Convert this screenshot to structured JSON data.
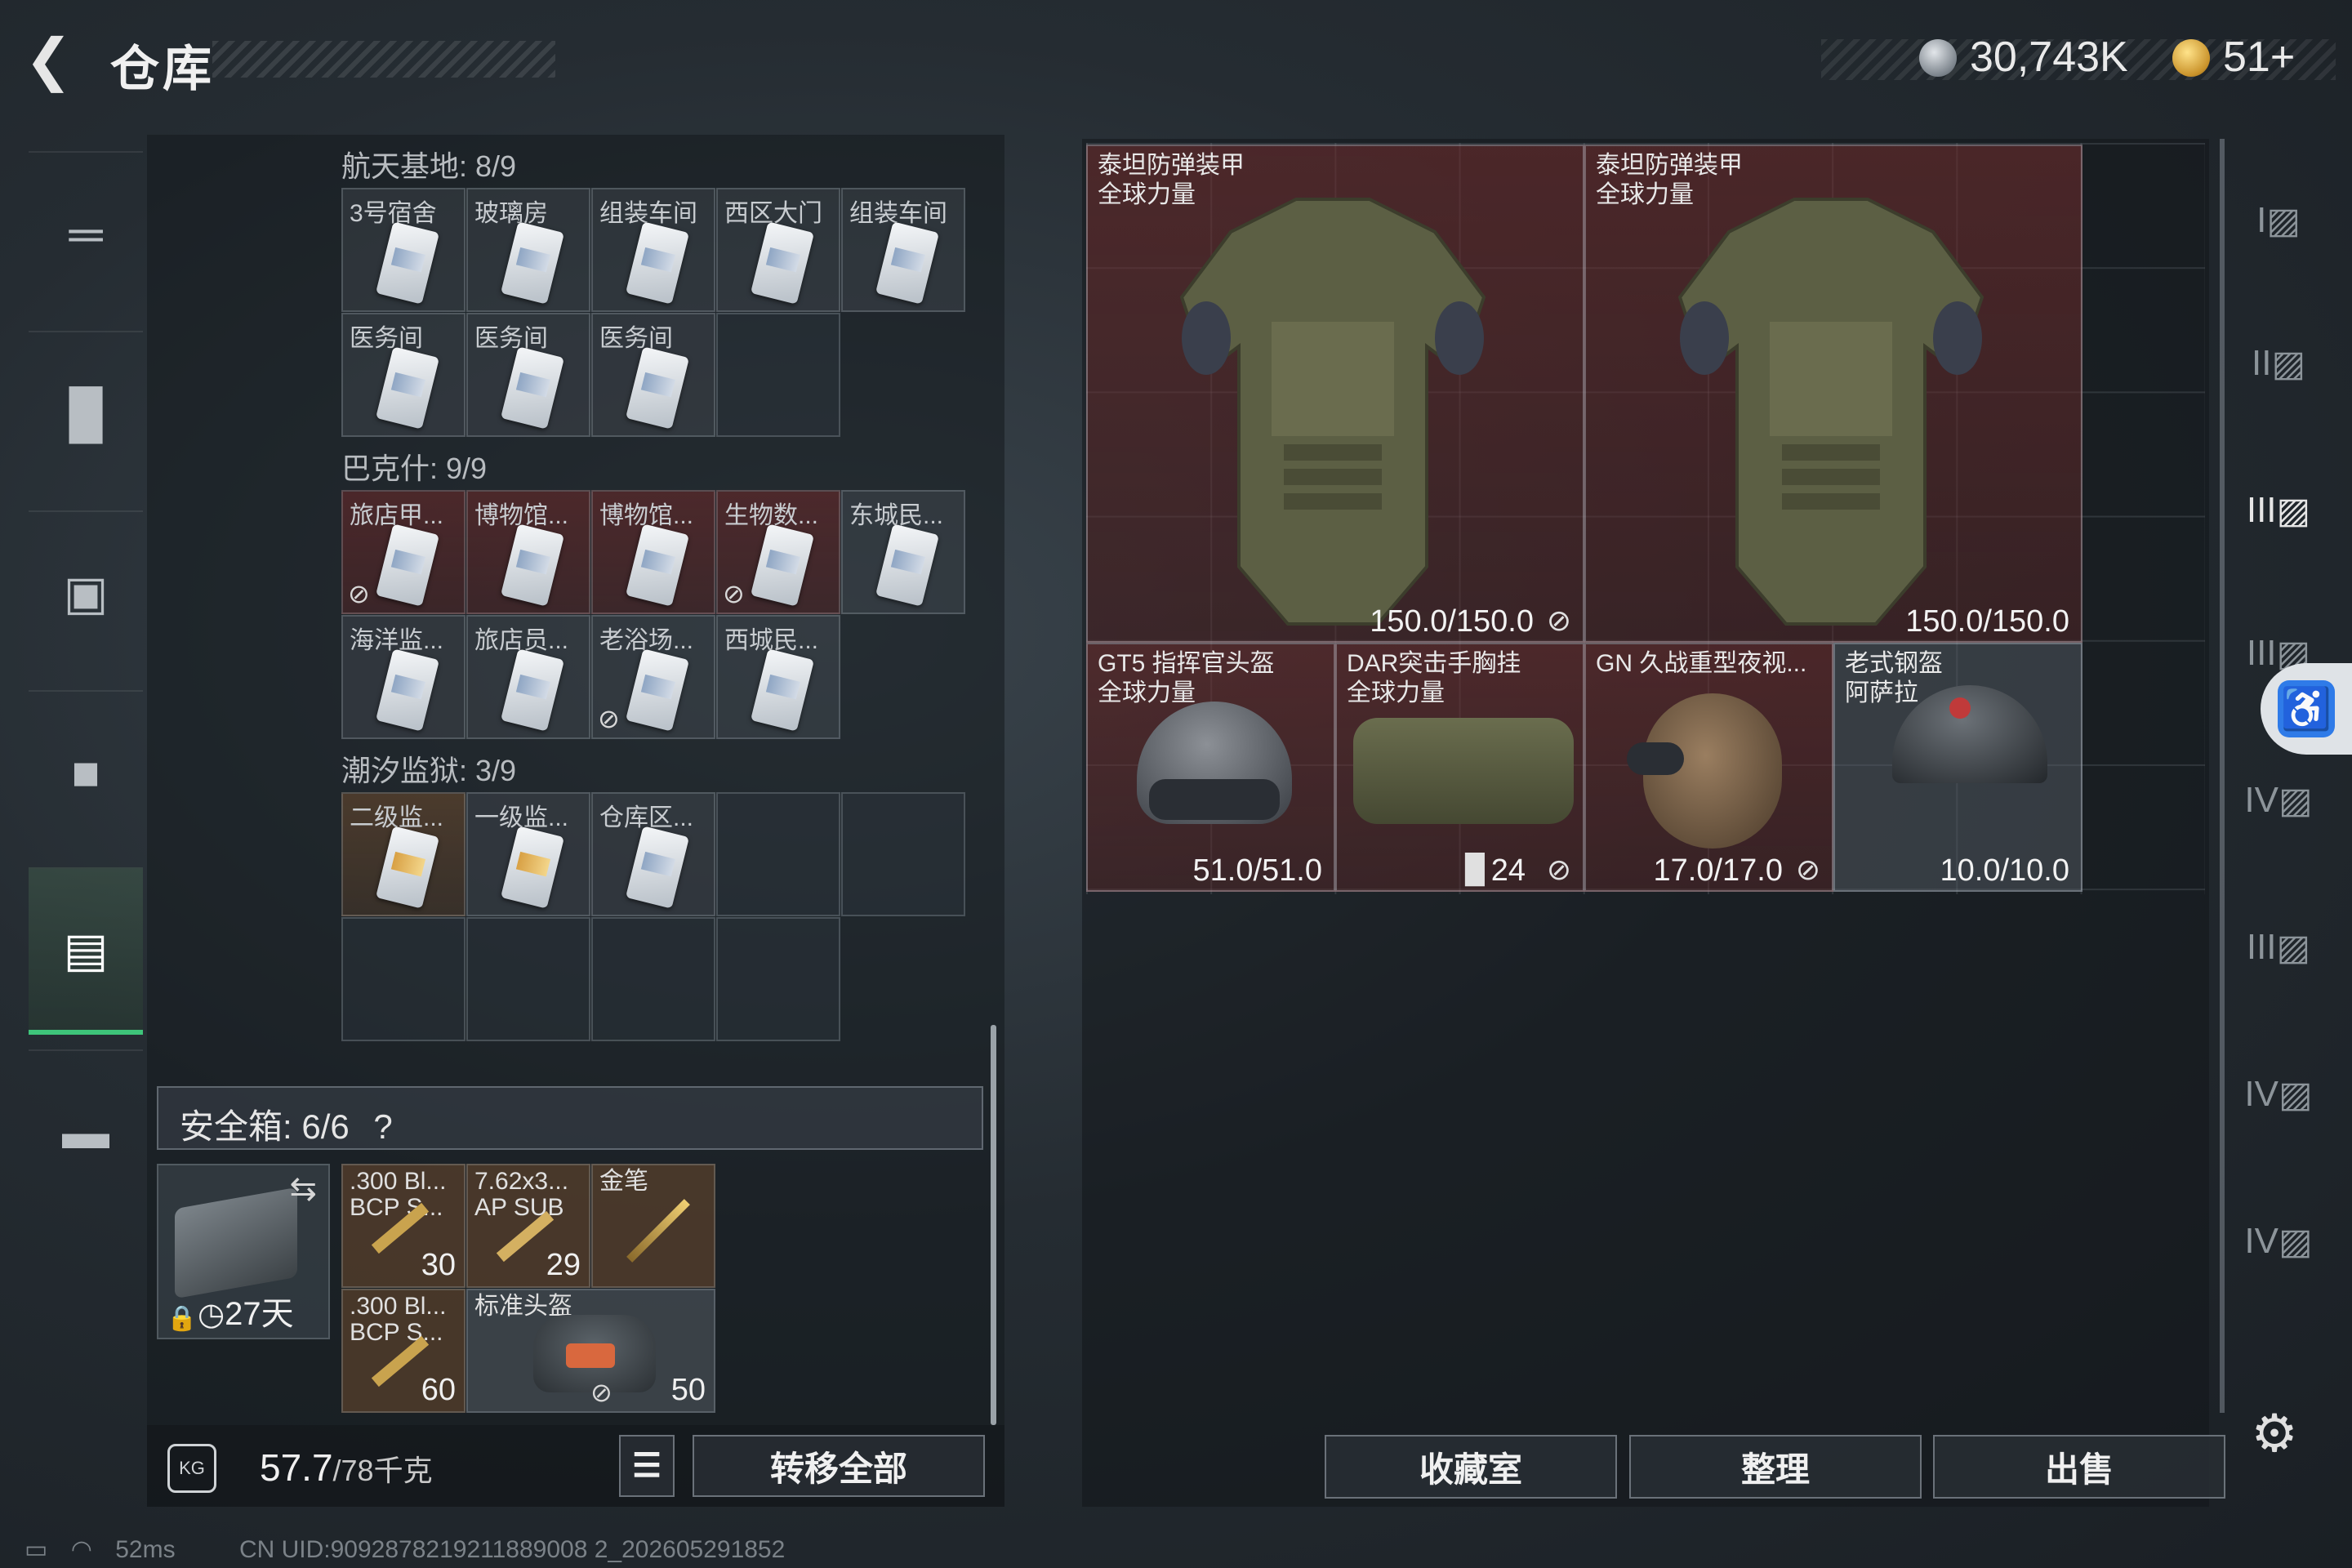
{
  "header": {
    "back_icon": "back-arrow-icon",
    "title": "仓库",
    "currency_silver": "30,743K",
    "currency_gold": "51+"
  },
  "left_nav": {
    "items": [
      "gun-icon",
      "vest-icon",
      "backpack-icon",
      "pouch-icon",
      "warehouse-icon",
      "toolbox-icon"
    ],
    "active": "warehouse-icon"
  },
  "sections": [
    {
      "title": "航天基地: 8/9",
      "items": [
        {
          "label": "3号宿舍",
          "color": "grey"
        },
        {
          "label": "玻璃房",
          "color": "grey"
        },
        {
          "label": "组装车间",
          "color": "grey"
        },
        {
          "label": "西区大门",
          "color": "grey"
        },
        {
          "label": "组装车间",
          "color": "grey"
        },
        {
          "label": "医务间",
          "color": "grey"
        },
        {
          "label": "医务间",
          "color": "grey"
        },
        {
          "label": "医务间",
          "color": "grey"
        }
      ]
    },
    {
      "title": "巴克什: 9/9",
      "items": [
        {
          "label": "旅店甲...",
          "color": "red",
          "no_sell": true
        },
        {
          "label": "博物馆...",
          "color": "red"
        },
        {
          "label": "博物馆...",
          "color": "red"
        },
        {
          "label": "生物数...",
          "color": "red",
          "no_sell": true
        },
        {
          "label": "东城民...",
          "color": "grey"
        },
        {
          "label": "海洋监...",
          "color": "grey"
        },
        {
          "label": "旅店员...",
          "color": "grey"
        },
        {
          "label": "老浴场...",
          "color": "grey",
          "no_sell": true
        },
        {
          "label": "西城民...",
          "color": "grey"
        }
      ]
    },
    {
      "title": "潮汐监狱: 3/9",
      "items": [
        {
          "label": "二级监...",
          "color": "brown",
          "gold": true
        },
        {
          "label": "一级监...",
          "color": "grey",
          "gold": true
        },
        {
          "label": "仓库区...",
          "color": "grey"
        }
      ]
    }
  ],
  "safe_box": {
    "label": "安全箱: 6/6",
    "help": "?",
    "timer": "27天",
    "swap_icon": "swap-icon",
    "items": [
      {
        "label": ".300 Bl...\nBCP S...",
        "qty": "30"
      },
      {
        "label": "7.62x3...\nAP SUB",
        "qty": "29"
      },
      {
        "label": "金笔",
        "qty": ""
      },
      {
        "label": ".300 Bl...\nBCP S...",
        "qty": "60"
      },
      {
        "label": "标准头盔",
        "qty": "50"
      }
    ]
  },
  "footer_left": {
    "weight_value": "57.7",
    "weight_unit": "/78千克",
    "weight_icon": "KG",
    "transfer_all": "转移全部"
  },
  "storage": {
    "items": [
      {
        "name": "泰坦防弹装甲\n全球力量",
        "durability": "150.0/150.0"
      },
      {
        "name": "泰坦防弹装甲\n全球力量",
        "durability": "150.0/150.0"
      },
      {
        "name": "GT5 指挥官头盔\n全球力量",
        "durability": "51.0/51.0"
      },
      {
        "name": "DAR突击手胸挂\n全球力量",
        "durability": "24"
      },
      {
        "name": "GN 久战重型夜视...",
        "durability": "17.0/17.0"
      },
      {
        "name": "老式钢盔\n阿萨拉",
        "durability": "10.0/10.0"
      }
    ]
  },
  "footer_right": {
    "collection": "收藏室",
    "sort": "整理",
    "sell": "出售"
  },
  "right_rail": [
    "I",
    "II",
    "III",
    "III",
    "IV",
    "III",
    "IV",
    "IV"
  ],
  "status": {
    "ping": "52ms",
    "uid": "CN UID:9092878219211889008 2_202605291852"
  }
}
